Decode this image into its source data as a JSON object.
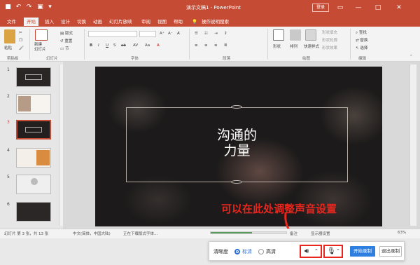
{
  "app": {
    "title": "演示文稿1 - PowerPoint",
    "login": "登录",
    "window_controls": [
      "—",
      "□",
      "✕"
    ]
  },
  "menu": {
    "items": [
      "文件",
      "开始",
      "插入",
      "设计",
      "切换",
      "动画",
      "幻灯片放映",
      "审阅",
      "视图",
      "帮助",
      "💡",
      "操作说明搜索"
    ],
    "active_index": 1
  },
  "ribbon": {
    "paste": "粘贴",
    "new_slide": "新建\n幻灯片",
    "layout": "版式",
    "reset": "重置",
    "section": "节",
    "font_bold_row": [
      "B",
      "I",
      "U",
      "S",
      "ab",
      "AV",
      "Aa",
      "A"
    ],
    "shapes": "形状",
    "arrange": "排列",
    "quick_styles": "快速样式",
    "shape_fill": "形状填充",
    "shape_outline": "形状轮廓",
    "shape_effects": "形状效果",
    "find": "查找",
    "replace": "替换",
    "select": "选择",
    "groups": [
      "剪贴板",
      "幻灯片",
      "字体",
      "段落",
      "绘图",
      "编辑"
    ]
  },
  "slides": [
    {
      "num": "1",
      "active": false
    },
    {
      "num": "2",
      "active": false
    },
    {
      "num": "3",
      "active": true
    },
    {
      "num": "4",
      "active": false
    },
    {
      "num": "5",
      "active": false
    },
    {
      "num": "6",
      "active": false
    }
  ],
  "slide": {
    "title_line1": "沟通的",
    "title_line2": "力量"
  },
  "annotation": {
    "text": "可以在此处调整声音设置"
  },
  "status": {
    "slide_info": "幻灯片 第 3 张，共 13 张",
    "language": "中文(简体，中国大陆)",
    "loading": "正在下载版式字体...",
    "notes": "备注",
    "display_settings": "显示器设置",
    "zoom": "63%",
    "progress": 0.55
  },
  "recorder": {
    "clarity_label": "清晰度",
    "option_standard": "标清",
    "option_hd": "高清",
    "selected": "标清",
    "start_label": "开始录制",
    "exit_label": "退出录制"
  },
  "colors": {
    "accent": "#c64b35",
    "annotation": "#e8261d",
    "primary_button": "#2f7fe0"
  }
}
